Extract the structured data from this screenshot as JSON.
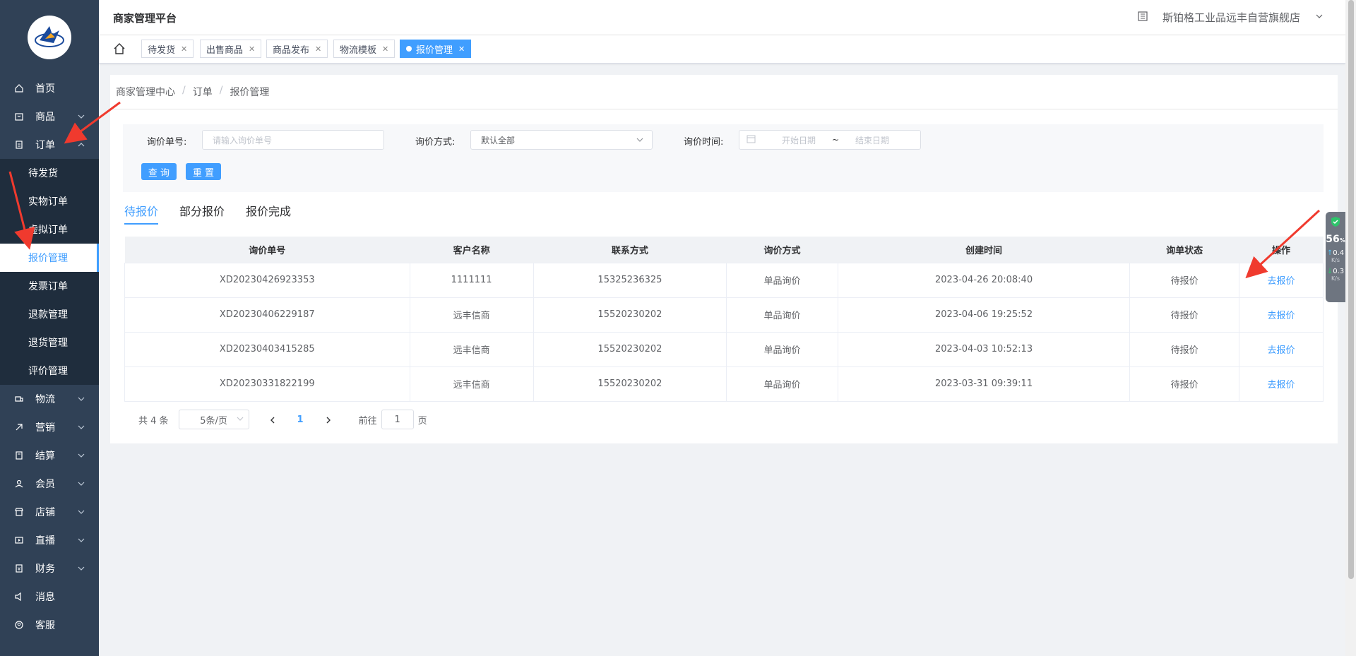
{
  "header": {
    "platform_title": "商家管理平台",
    "store_name": "斯铂格工业品远丰自营旗舰店"
  },
  "sidebar": {
    "items": [
      {
        "label": "首页",
        "icon": "home-icon"
      },
      {
        "label": "商品",
        "icon": "goods-icon"
      },
      {
        "label": "订单",
        "icon": "order-icon"
      },
      {
        "label": "物流",
        "icon": "logistics-icon"
      },
      {
        "label": "营销",
        "icon": "marketing-icon"
      },
      {
        "label": "结算",
        "icon": "settlement-icon"
      },
      {
        "label": "会员",
        "icon": "member-icon"
      },
      {
        "label": "店铺",
        "icon": "store-icon"
      },
      {
        "label": "直播",
        "icon": "live-icon"
      },
      {
        "label": "财务",
        "icon": "finance-icon"
      },
      {
        "label": "消息",
        "icon": "message-icon"
      },
      {
        "label": "客服",
        "icon": "service-icon"
      }
    ],
    "order_submenu": [
      "待发货",
      "实物订单",
      "虚拟订单",
      "报价管理",
      "发票订单",
      "退款管理",
      "退货管理",
      "评价管理"
    ]
  },
  "tags": [
    "待发货",
    "出售商品",
    "商品发布",
    "物流模板",
    "报价管理"
  ],
  "breadcrumb": [
    "商家管理中心",
    "订单",
    "报价管理"
  ],
  "search": {
    "inquiry_no_label": "询价单号:",
    "inquiry_no_placeholder": "请输入询价单号",
    "method_label": "询价方式:",
    "method_value": "默认全部",
    "time_label": "询价时间:",
    "start_placeholder": "开始日期",
    "range_sep": "~",
    "end_placeholder": "结束日期",
    "query_button": "查 询",
    "reset_button": "重 置"
  },
  "tabs": [
    "待报价",
    "部分报价",
    "报价完成"
  ],
  "table": {
    "columns": [
      "询价单号",
      "客户名称",
      "联系方式",
      "询价方式",
      "创建时间",
      "询单状态",
      "操作"
    ],
    "rows": [
      [
        "XD20230426923353",
        "1111111",
        "15325236325",
        "单品询价",
        "2023-04-26 20:08:40",
        "待报价",
        "去报价"
      ],
      [
        "XD20230406229187",
        "远丰信商",
        "15520230202",
        "单品询价",
        "2023-04-06 19:25:52",
        "待报价",
        "去报价"
      ],
      [
        "XD20230403415285",
        "远丰信商",
        "15520230202",
        "单品询价",
        "2023-04-03 10:52:13",
        "待报价",
        "去报价"
      ],
      [
        "XD20230331822199",
        "远丰信商",
        "15520230202",
        "单品询价",
        "2023-03-31 09:39:11",
        "待报价",
        "去报价"
      ]
    ]
  },
  "pagination": {
    "total": "共 4 条",
    "page_size": "5条/页",
    "current_page": "1",
    "goto_prefix": "前往",
    "goto_value": "1",
    "goto_suffix": "页"
  },
  "widget": {
    "percent": "56",
    "percent_unit": "%",
    "up_speed": "0.4",
    "down_speed": "0.3",
    "speed_unit": "K/s"
  },
  "colors": {
    "sidebar_bg": "#304156",
    "submenu_bg": "#1f2d3d",
    "accent": "#409eff",
    "annotation_red": "#f03a2e"
  }
}
